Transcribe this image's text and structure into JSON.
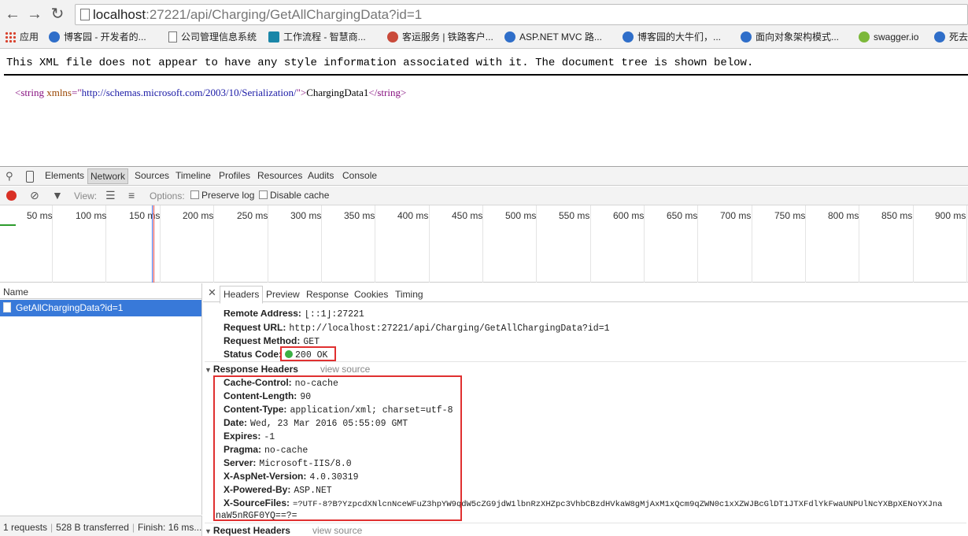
{
  "browser": {
    "url_host": "localhost",
    "url_rest": ":27221/api/Charging/GetAllChargingData?id=1",
    "bookmarks": [
      {
        "label": "应用",
        "icon": "apps-grid-icon"
      },
      {
        "label": "博客园 - 开发者的...",
        "icon": "cnblogs-icon"
      },
      {
        "label": "公司管理信息系统",
        "icon": "document-icon"
      },
      {
        "label": "工作流程 - 智慧商...",
        "icon": "workflow-icon"
      },
      {
        "label": "客运服务 | 铁路客户...",
        "icon": "railway-icon"
      },
      {
        "label": "ASP.NET MVC 路...",
        "icon": "cnblogs-icon"
      },
      {
        "label": "博客园的大牛们，...",
        "icon": "cnblogs-icon"
      },
      {
        "label": "面向对象架构模式...",
        "icon": "cnblogs-icon"
      },
      {
        "label": "swagger.io",
        "icon": "swagger-icon"
      },
      {
        "label": "死去",
        "icon": "cnblogs-icon"
      }
    ]
  },
  "xml_view": {
    "notice": "This XML file does not appear to have any style information associated with it. The document tree is shown below.",
    "open_tag": "<string",
    "attr_name": " xmlns",
    "attr_eq": "=\"",
    "attr_value": "http://schemas.microsoft.com/2003/10/Serialization/",
    "attr_close": "\">",
    "text": "ChargingData1",
    "close_tag": "</string>"
  },
  "devtools": {
    "tabs": [
      "Elements",
      "Network",
      "Sources",
      "Timeline",
      "Profiles",
      "Resources",
      "Audits",
      "Console"
    ],
    "active_tab": "Network",
    "toolbar": {
      "view_label": "View:",
      "options_label": "Options:",
      "preserve_log": "Preserve log",
      "disable_cache": "Disable cache"
    },
    "timeline_ticks": [
      "50 ms",
      "100 ms",
      "150 ms",
      "200 ms",
      "250 ms",
      "300 ms",
      "350 ms",
      "400 ms",
      "450 ms",
      "500 ms",
      "550 ms",
      "600 ms",
      "650 ms",
      "700 ms",
      "750 ms",
      "800 ms",
      "850 ms",
      "900 ms"
    ],
    "name_column": "Name",
    "request_name": "GetAllChargingData?id=1",
    "status": {
      "requests": "1 requests",
      "transferred": "528 B transferred",
      "finish": "Finish: 16 ms..."
    },
    "detail_tabs": [
      "Headers",
      "Preview",
      "Response",
      "Cookies",
      "Timing"
    ],
    "active_detail_tab": "Headers",
    "general": [
      {
        "key": "Remote Address:",
        "value": "[::1]:27221"
      },
      {
        "key": "Request URL:",
        "value": "http://localhost:27221/api/Charging/GetAllChargingData?id=1"
      },
      {
        "key": "Request Method:",
        "value": "GET"
      },
      {
        "key": "Status Code:",
        "value": "200 OK"
      }
    ],
    "response_headers_title": "Response Headers",
    "view_source": "view source",
    "response_headers": [
      {
        "key": "Cache-Control:",
        "value": "no-cache"
      },
      {
        "key": "Content-Length:",
        "value": "90"
      },
      {
        "key": "Content-Type:",
        "value": "application/xml; charset=utf-8"
      },
      {
        "key": "Date:",
        "value": "Wed, 23 Mar 2016 05:55:09 GMT"
      },
      {
        "key": "Expires:",
        "value": "-1"
      },
      {
        "key": "Pragma:",
        "value": "no-cache"
      },
      {
        "key": "Server:",
        "value": "Microsoft-IIS/8.0"
      },
      {
        "key": "X-AspNet-Version:",
        "value": "4.0.30319"
      },
      {
        "key": "X-Powered-By:",
        "value": "ASP.NET"
      },
      {
        "key": "X-SourceFiles:",
        "value": "=?UTF-8?B?YzpcdXNlcnNceWFuZ3hpYW9qdW5cZG9jdW1lbnRzXHZpc3VhbCBzdHVkaW8gMjAxM1xQcm9qZWN0c1xXZWJBcGlDT1JTXFdlYkFwaUNPUlNcYXBpXENoYXJna"
      },
      {
        "key": "",
        "value": "naW5nRGF0YQ==?="
      }
    ],
    "request_headers_title": "Request Headers"
  }
}
